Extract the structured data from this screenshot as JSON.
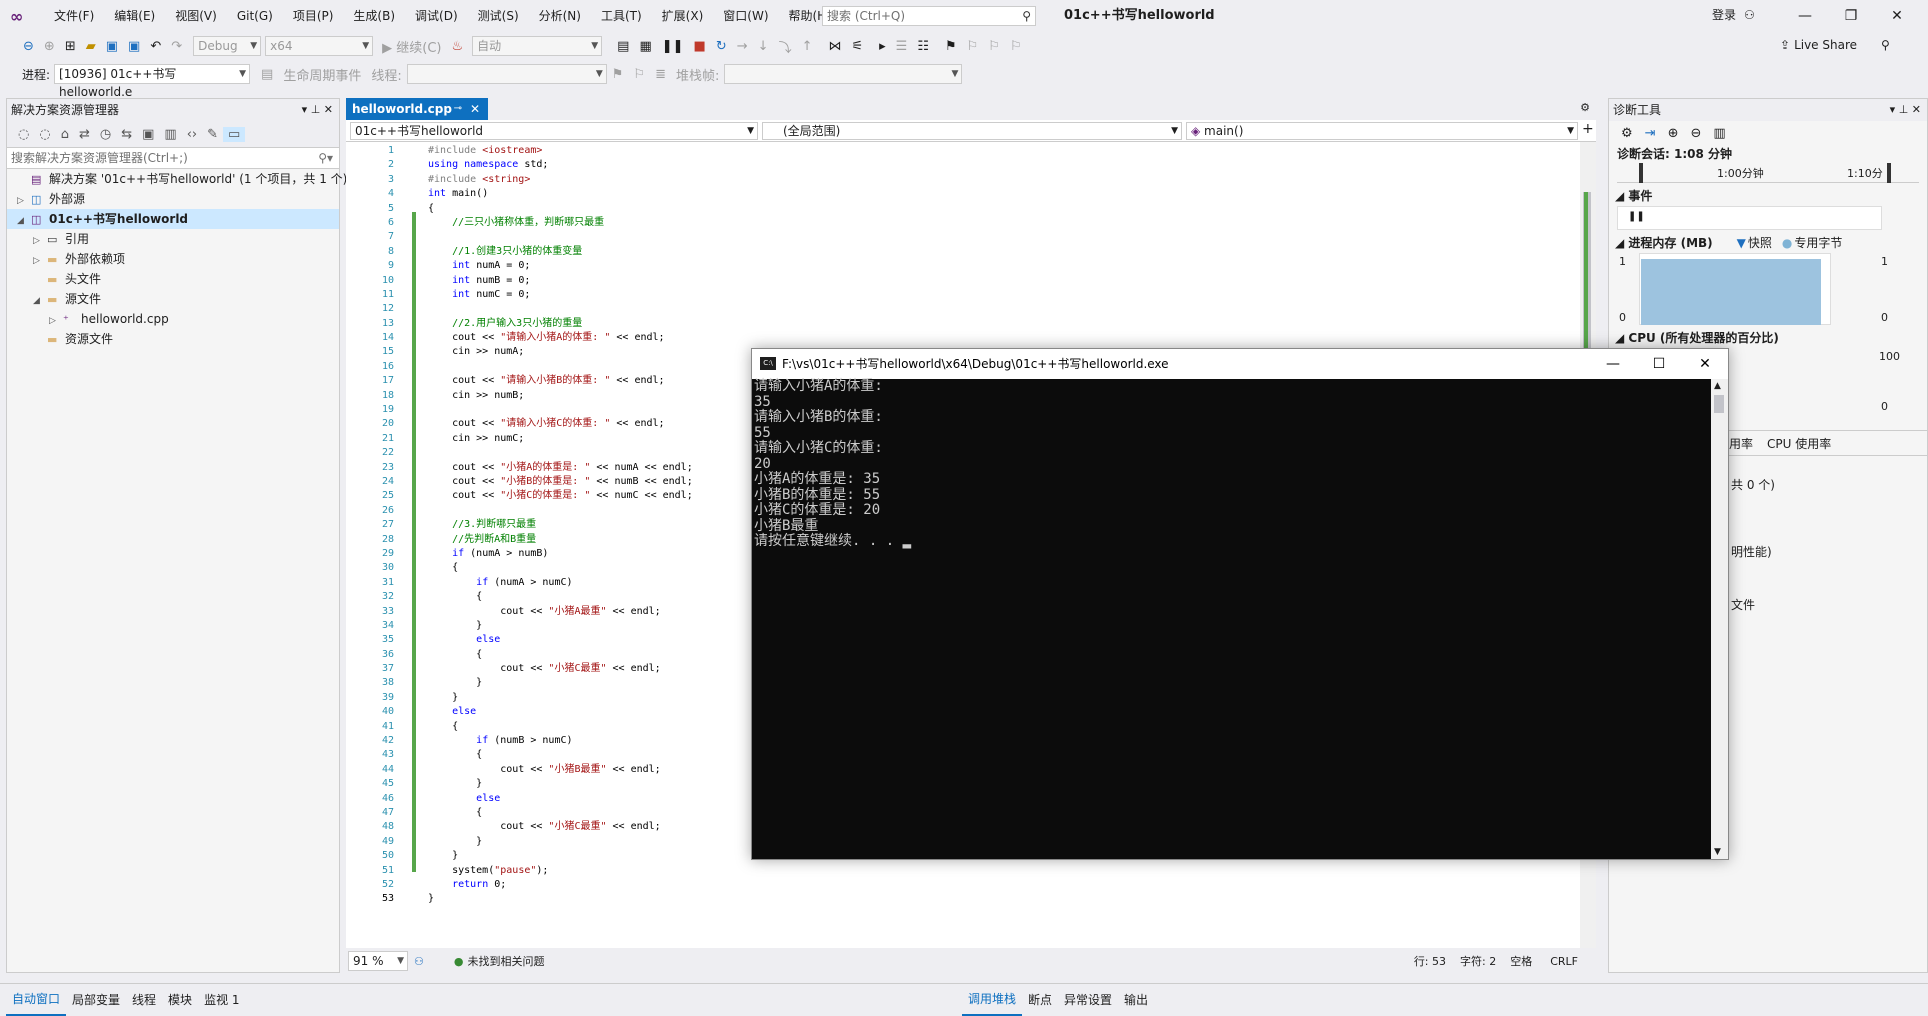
{
  "titlebar": {
    "menu": [
      "文件(F)",
      "编辑(E)",
      "视图(V)",
      "Git(G)",
      "项目(P)",
      "生成(B)",
      "调试(D)",
      "测试(S)",
      "分析(N)",
      "工具(T)",
      "扩展(X)",
      "窗口(W)",
      "帮助(H)"
    ],
    "search_placeholder": "搜索 (Ctrl+Q)",
    "window_title": "01c++书写helloworld",
    "login": "登录"
  },
  "toolbar": {
    "config": "Debug",
    "platform": "x64",
    "continue": "继续(C)",
    "auto": "自动",
    "liveshare": "Live Share",
    "process_label": "进程:",
    "process_value": "[10936] 01c++书写helloworld.e",
    "lifecycle": "生命周期事件",
    "thread_label": "线程:",
    "stack_label": "堆栈帧:"
  },
  "solution_explorer": {
    "title": "解决方案资源管理器",
    "search_placeholder": "搜索解决方案资源管理器(Ctrl+;)",
    "items": [
      {
        "label": "解决方案 '01c++书写helloworld' (1 个项目，共 1 个)",
        "indent": 0,
        "arrow": "",
        "icon": "solution-icon"
      },
      {
        "label": "外部源",
        "indent": 0,
        "arrow": "▷",
        "icon": "external-icon"
      },
      {
        "label": "01c++书写helloworld",
        "indent": 0,
        "arrow": "◢",
        "icon": "project-icon",
        "selected": true
      },
      {
        "label": "引用",
        "indent": 1,
        "arrow": "▷",
        "icon": "reference-icon"
      },
      {
        "label": "外部依赖项",
        "indent": 1,
        "arrow": "▷",
        "icon": "folder-icon"
      },
      {
        "label": "头文件",
        "indent": 1,
        "arrow": "",
        "icon": "folder-icon"
      },
      {
        "label": "源文件",
        "indent": 1,
        "arrow": "◢",
        "icon": "folder-icon"
      },
      {
        "label": "helloworld.cpp",
        "indent": 2,
        "arrow": "▷",
        "icon": "cpp-file-icon"
      },
      {
        "label": "资源文件",
        "indent": 1,
        "arrow": "",
        "icon": "folder-icon"
      }
    ]
  },
  "editor": {
    "tab": "helloworld.cpp",
    "nav_project": "01c++书写helloworld",
    "nav_scope": "(全局范围)",
    "nav_member": "main()",
    "zoom": "91 %",
    "issues": "未找到相关问题",
    "line": "行: 53",
    "col": "字符: 2",
    "space": "空格",
    "eol": "CRLF"
  },
  "code": [
    [
      [
        "pp",
        "#include "
      ],
      [
        "inc",
        "<iostream>"
      ]
    ],
    [
      [
        "kw",
        "using namespace "
      ],
      [
        "",
        "std;"
      ]
    ],
    [
      [
        "pp",
        "#include "
      ],
      [
        "inc",
        "<string>"
      ]
    ],
    [
      [
        "kw",
        "int "
      ],
      [
        "",
        "main()"
      ]
    ],
    [
      [
        "",
        "{"
      ]
    ],
    [
      [
        "",
        "    "
      ],
      [
        "cm",
        "//三只小猪称体重，判断哪只最重"
      ]
    ],
    [
      [
        "",
        ""
      ]
    ],
    [
      [
        "",
        "    "
      ],
      [
        "cm",
        "//1.创建3只小猪的体重变量"
      ]
    ],
    [
      [
        "",
        "    "
      ],
      [
        "kw",
        "int "
      ],
      [
        "",
        "numA = 0;"
      ]
    ],
    [
      [
        "",
        "    "
      ],
      [
        "kw",
        "int "
      ],
      [
        "",
        "numB = 0;"
      ]
    ],
    [
      [
        "",
        "    "
      ],
      [
        "kw",
        "int "
      ],
      [
        "",
        "numC = 0;"
      ]
    ],
    [
      [
        "",
        ""
      ]
    ],
    [
      [
        "",
        "    "
      ],
      [
        "cm",
        "//2.用户输入3只小猪的重量"
      ]
    ],
    [
      [
        "",
        "    cout << "
      ],
      [
        "st",
        "\"请输入小猪A的体重: \""
      ],
      [
        "",
        " << endl;"
      ]
    ],
    [
      [
        "",
        "    cin >> numA;"
      ]
    ],
    [
      [
        "",
        ""
      ]
    ],
    [
      [
        "",
        "    cout << "
      ],
      [
        "st",
        "\"请输入小猪B的体重: \""
      ],
      [
        "",
        " << endl;"
      ]
    ],
    [
      [
        "",
        "    cin >> numB;"
      ]
    ],
    [
      [
        "",
        ""
      ]
    ],
    [
      [
        "",
        "    cout << "
      ],
      [
        "st",
        "\"请输入小猪C的体重: \""
      ],
      [
        "",
        " << endl;"
      ]
    ],
    [
      [
        "",
        "    cin >> numC;"
      ]
    ],
    [
      [
        "",
        ""
      ]
    ],
    [
      [
        "",
        "    cout << "
      ],
      [
        "st",
        "\"小猪A的体重是: \""
      ],
      [
        "",
        " << numA << endl;"
      ]
    ],
    [
      [
        "",
        "    cout << "
      ],
      [
        "st",
        "\"小猪B的体重是: \""
      ],
      [
        "",
        " << numB << endl;"
      ]
    ],
    [
      [
        "",
        "    cout << "
      ],
      [
        "st",
        "\"小猪C的体重是: \""
      ],
      [
        "",
        " << numC << endl;"
      ]
    ],
    [
      [
        "",
        ""
      ]
    ],
    [
      [
        "",
        "    "
      ],
      [
        "cm",
        "//3.判断哪只最重"
      ]
    ],
    [
      [
        "",
        "    "
      ],
      [
        "cm",
        "//先判断A和B重量"
      ]
    ],
    [
      [
        "",
        "    "
      ],
      [
        "kw",
        "if "
      ],
      [
        "",
        "(numA > numB)"
      ]
    ],
    [
      [
        "",
        "    {"
      ]
    ],
    [
      [
        "",
        "        "
      ],
      [
        "kw",
        "if "
      ],
      [
        "",
        "(numA > numC)"
      ]
    ],
    [
      [
        "",
        "        {"
      ]
    ],
    [
      [
        "",
        "            cout << "
      ],
      [
        "st",
        "\"小猪A最重\""
      ],
      [
        "",
        " << endl;"
      ]
    ],
    [
      [
        "",
        "        }"
      ]
    ],
    [
      [
        "",
        "        "
      ],
      [
        "kw",
        "else"
      ]
    ],
    [
      [
        "",
        "        {"
      ]
    ],
    [
      [
        "",
        "            cout << "
      ],
      [
        "st",
        "\"小猪C最重\""
      ],
      [
        "",
        " << endl;"
      ]
    ],
    [
      [
        "",
        "        }"
      ]
    ],
    [
      [
        "",
        "    }"
      ]
    ],
    [
      [
        "",
        "    "
      ],
      [
        "kw",
        "else"
      ]
    ],
    [
      [
        "",
        "    {"
      ]
    ],
    [
      [
        "",
        "        "
      ],
      [
        "kw",
        "if "
      ],
      [
        "",
        "(numB > numC)"
      ]
    ],
    [
      [
        "",
        "        {"
      ]
    ],
    [
      [
        "",
        "            cout << "
      ],
      [
        "st",
        "\"小猪B最重\""
      ],
      [
        "",
        " << endl;"
      ]
    ],
    [
      [
        "",
        "        }"
      ]
    ],
    [
      [
        "",
        "        "
      ],
      [
        "kw",
        "else"
      ]
    ],
    [
      [
        "",
        "        {"
      ]
    ],
    [
      [
        "",
        "            cout << "
      ],
      [
        "st",
        "\"小猪C最重\""
      ],
      [
        "",
        " << endl;"
      ]
    ],
    [
      [
        "",
        "        }"
      ]
    ],
    [
      [
        "",
        "    }"
      ]
    ],
    [
      [
        "",
        "    system("
      ],
      [
        "st",
        "\"pause\""
      ],
      [
        "",
        ");"
      ]
    ],
    [
      [
        "",
        "    "
      ],
      [
        "kw",
        "return "
      ],
      [
        "",
        "0;"
      ]
    ],
    [
      [
        "",
        "}"
      ]
    ]
  ],
  "diagnostics": {
    "title": "诊断工具",
    "session": "诊断会话: 1:08 分钟",
    "time1": "1:00分钟",
    "time2": "1:10分",
    "events": "事件",
    "memory": "进程内存 (MB)",
    "snapshot": "快照",
    "private": "专用字节",
    "mem_max": "1",
    "mem_min": "0",
    "cpu": "CPU (所有处理器的百分比)",
    "cpu_max": "100",
    "cpu_min": "0",
    "tab_usage": "用率",
    "tab_cpu": "CPU 使用率",
    "line_a": "共 0 个)",
    "line_b": "明性能)",
    "line_c": "文件"
  },
  "console": {
    "title": "F:\\vs\\01c++书写helloworld\\x64\\Debug\\01c++书写helloworld.exe",
    "lines": [
      "请输入小猪A的体重:",
      "35",
      "请输入小猪B的体重:",
      "55",
      "请输入小猪C的体重:",
      "20",
      "小猪A的体重是: 35",
      "小猪B的体重是: 55",
      "小猪C的体重是: 20",
      "小猪B最重",
      "请按任意键继续. . ."
    ]
  },
  "bottom": {
    "left_tabs": [
      "自动窗口",
      "局部变量",
      "线程",
      "模块",
      "监视 1"
    ],
    "right_tabs": [
      "调用堆栈",
      "断点",
      "异常设置",
      "输出"
    ]
  }
}
